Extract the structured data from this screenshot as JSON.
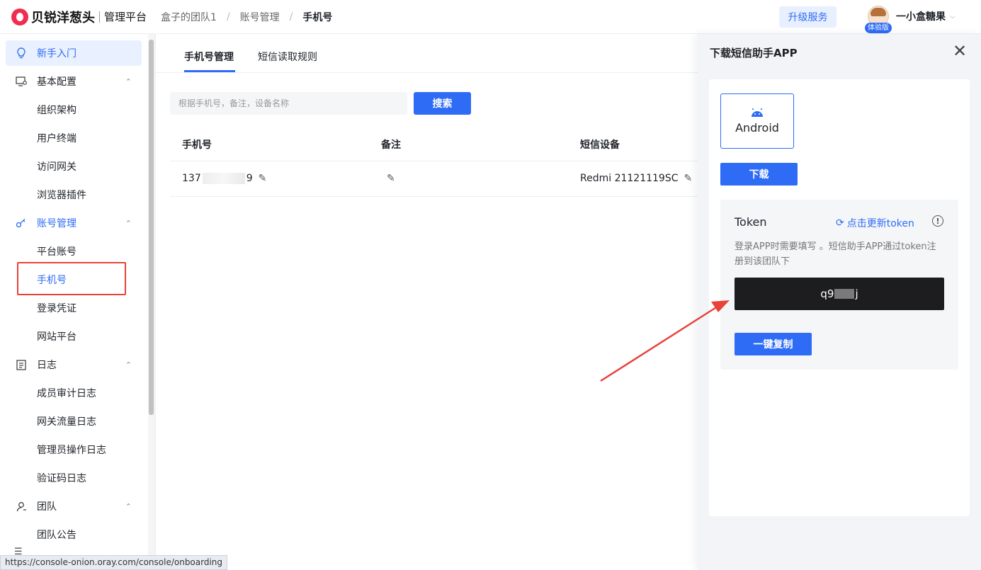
{
  "header": {
    "brand_name": "贝锐洋葱头",
    "brand_sub": "管理平台",
    "breadcrumb": [
      "盒子的团队1",
      "账号管理",
      "手机号"
    ],
    "upgrade_label": "升级服务",
    "username": "一小盒糖果",
    "trial_badge": "体验版",
    "accent_color": "#2f6cf5"
  },
  "sidebar": {
    "items": [
      {
        "label": "新手入门",
        "icon": "bulb-icon",
        "active": true
      },
      {
        "label": "基本配置",
        "icon": "monitor-settings-icon",
        "expanded": true,
        "children": [
          "组织架构",
          "用户终端",
          "访问网关",
          "浏览器插件"
        ]
      },
      {
        "label": "账号管理",
        "icon": "key-icon",
        "expanded": true,
        "children": [
          "平台账号",
          "手机号",
          "登录凭证",
          "网站平台"
        ],
        "current_child": "手机号"
      },
      {
        "label": "日志",
        "icon": "log-icon",
        "expanded": true,
        "children": [
          "成员审计日志",
          "网关流量日志",
          "管理员操作日志",
          "验证码日志"
        ]
      },
      {
        "label": "团队",
        "icon": "user-icon",
        "expanded": true,
        "children": [
          "团队公告"
        ]
      }
    ]
  },
  "main": {
    "tabs": [
      {
        "label": "手机号管理",
        "active": true
      },
      {
        "label": "短信读取规则",
        "active": false
      }
    ],
    "search": {
      "placeholder": "根据手机号，备注，设备名称",
      "button_label": "搜索"
    },
    "table": {
      "columns": [
        "手机号",
        "备注",
        "短信设备"
      ],
      "rows": [
        {
          "phone_prefix": "137",
          "phone_suffix": "9",
          "note": "",
          "device": "Redmi 21121119SC"
        }
      ]
    }
  },
  "drawer": {
    "title": "下载短信助手APP",
    "platform": "Android",
    "download_label": "下载",
    "token": {
      "title": "Token",
      "refresh_label": "点击更新token",
      "description": "登录APP时需要填写 。短信助手APP通过token注册到该团队下",
      "value_prefix": "q9",
      "value_suffix": "j",
      "copy_label": "一键复制"
    }
  },
  "status_bar": {
    "url": "https://console-onion.oray.com/console/onboarding"
  },
  "annotation_color": "#e8423a"
}
